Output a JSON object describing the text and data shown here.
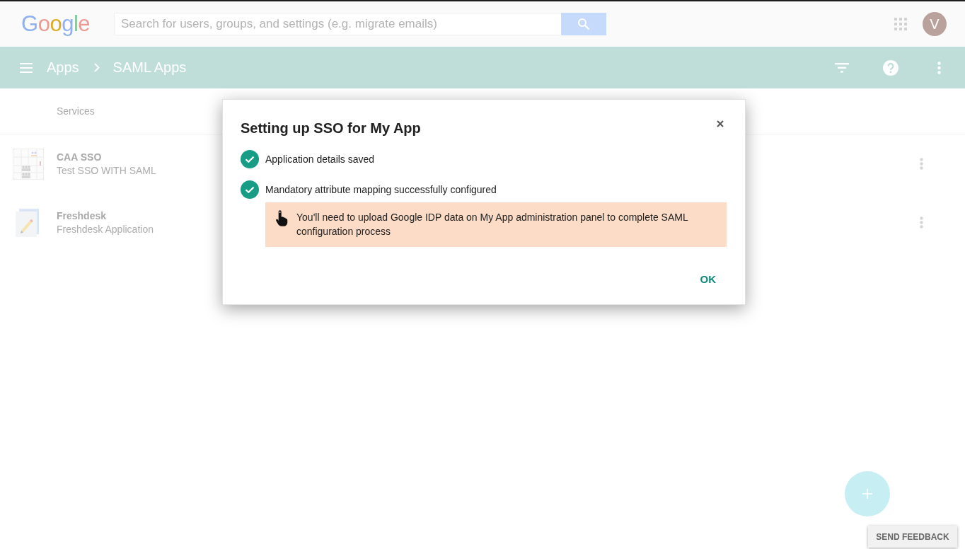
{
  "header": {
    "logo": "Google",
    "search": {
      "placeholder": "Search for users, groups, and settings (e.g. migrate emails)"
    },
    "avatar": "V"
  },
  "toolbar": {
    "breadcrumbs": [
      {
        "label": "Apps"
      },
      {
        "label": "SAML Apps"
      }
    ]
  },
  "table": {
    "columns": [
      "Services"
    ],
    "rows": [
      {
        "kind": "diagram",
        "name": "CAA SSO",
        "description": "Test SSO WITH SAML"
      },
      {
        "kind": "document",
        "name": "Freshdesk",
        "description": "Freshdesk Application"
      }
    ]
  },
  "dialog": {
    "title": "Setting up SSO for My App",
    "steps": [
      {
        "label": "Application details saved",
        "done": true
      },
      {
        "label": "Mandatory attribute mapping successfully configured",
        "done": true
      }
    ],
    "notice": "You'll need to upload Google IDP data on My App administration panel to complete SAML configuration process",
    "button": "OK"
  },
  "feedback_button": "SEND FEEDBACK"
}
